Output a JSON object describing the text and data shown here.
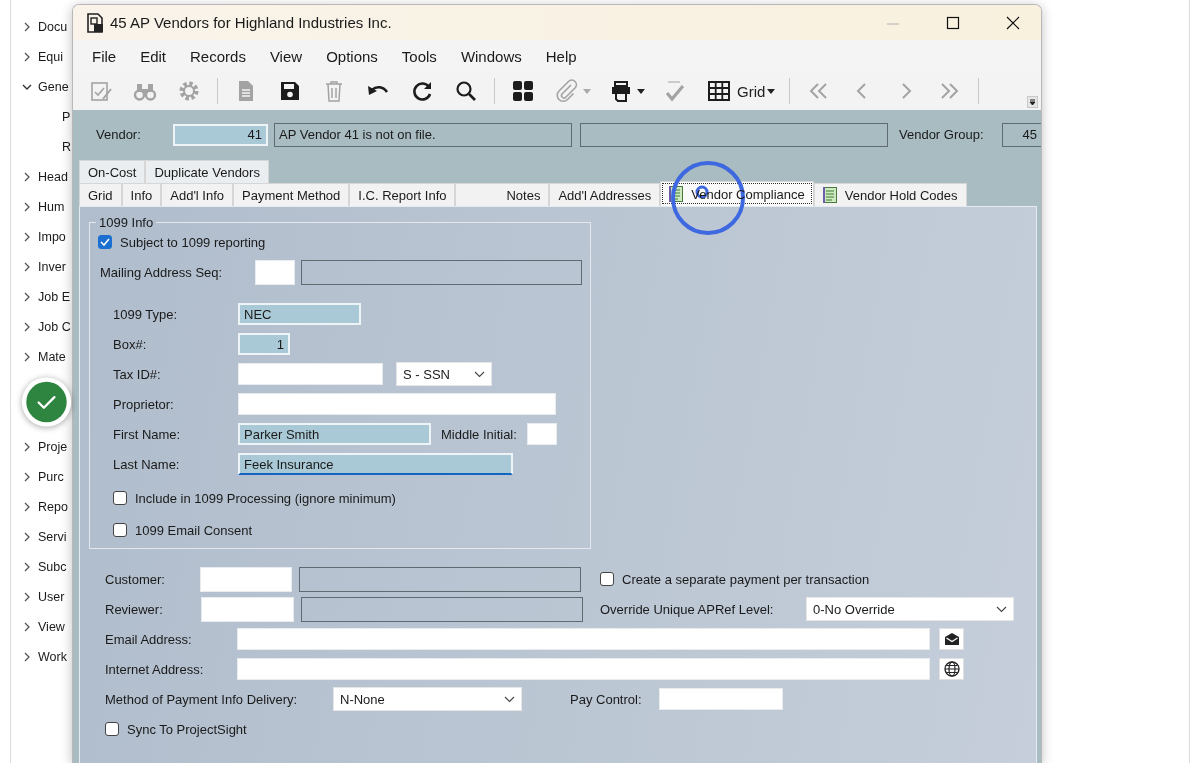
{
  "sidebar": {
    "items": [
      {
        "kind": "node",
        "label": "Docu",
        "expanded": false
      },
      {
        "kind": "node",
        "label": "Equi",
        "expanded": false
      },
      {
        "kind": "node",
        "label": "Gene",
        "expanded": true,
        "children": [
          {
            "label": "P"
          },
          {
            "label": "R"
          }
        ]
      },
      {
        "kind": "node",
        "label": "Head",
        "expanded": false
      },
      {
        "kind": "node",
        "label": "Hum",
        "expanded": false
      },
      {
        "kind": "node",
        "label": "Impo",
        "expanded": false
      },
      {
        "kind": "node",
        "label": "Inver",
        "expanded": false
      },
      {
        "kind": "node",
        "label": "Job E",
        "expanded": false
      },
      {
        "kind": "node",
        "label": "Job C",
        "expanded": false
      },
      {
        "kind": "node",
        "label": "Mate",
        "expanded": false
      },
      {
        "kind": "badge"
      },
      {
        "kind": "node",
        "label": "Proje",
        "expanded": false
      },
      {
        "kind": "node",
        "label": "Purc",
        "expanded": false
      },
      {
        "kind": "node",
        "label": "Repo",
        "expanded": false
      },
      {
        "kind": "node",
        "label": "Servi",
        "expanded": false
      },
      {
        "kind": "node",
        "label": "Subc",
        "expanded": false
      },
      {
        "kind": "node",
        "label": "User",
        "expanded": false
      },
      {
        "kind": "node",
        "label": "View",
        "expanded": false
      },
      {
        "kind": "node",
        "label": "Work",
        "expanded": false
      }
    ]
  },
  "window": {
    "title": "45 AP Vendors for Highland Industries Inc.",
    "controls": [
      {
        "disabled": true
      },
      {
        "disabled": false
      },
      {
        "disabled": false
      }
    ]
  },
  "menu": [
    "File",
    "Edit",
    "Records",
    "View",
    "Options",
    "Tools",
    "Windows",
    "Help"
  ],
  "toolbar": {
    "items": [
      {
        "kind": "button",
        "disabled": true
      },
      {
        "kind": "button",
        "disabled": true
      },
      {
        "kind": "button",
        "disabled": true
      },
      {
        "kind": "separator"
      },
      {
        "kind": "button",
        "disabled": true
      },
      {
        "kind": "button",
        "disabled": false
      },
      {
        "kind": "button",
        "disabled": true
      },
      {
        "kind": "button",
        "disabled": false
      },
      {
        "kind": "button",
        "disabled": false
      },
      {
        "kind": "button",
        "disabled": false
      },
      {
        "kind": "separator"
      },
      {
        "kind": "button",
        "disabled": false
      },
      {
        "kind": "split",
        "disabled": true
      },
      {
        "kind": "split",
        "disabled": false
      },
      {
        "kind": "button",
        "disabled": true
      },
      {
        "kind": "split",
        "disabled": false,
        "label": "Grid"
      },
      {
        "kind": "separator"
      },
      {
        "kind": "button",
        "disabled": true
      },
      {
        "kind": "button",
        "disabled": true
      },
      {
        "kind": "button",
        "disabled": true
      },
      {
        "kind": "button",
        "disabled": true
      },
      {
        "kind": "separator"
      }
    ]
  },
  "vendor_bar": {
    "vendor_label": "Vendor:",
    "vendor": "41",
    "description": "AP Vendor 41 is not on file.",
    "vendor_group_label": "Vendor Group:",
    "vendor_group": "45"
  },
  "tabs": {
    "row_1": [
      {
        "label": "On-Cost",
        "selected": false
      },
      {
        "label": "Duplicate Vendors",
        "selected": false
      }
    ],
    "row_2": [
      {
        "label": "Grid",
        "selected": false
      },
      {
        "label": "Info",
        "selected": false
      },
      {
        "label": "Add'l Info",
        "selected": false
      },
      {
        "label": "Payment Method",
        "selected": false
      },
      {
        "label": "I.C. Report Info",
        "selected": false
      },
      {
        "label": "Notes",
        "selected": false
      },
      {
        "label": "Add'l Addresses",
        "selected": false
      },
      {
        "label": "Vendor Compliance",
        "selected": true,
        "has_icon": true
      },
      {
        "label": "Vendor Hold Codes",
        "selected": false,
        "has_icon": true
      }
    ]
  },
  "info_1099": {
    "title": "1099 Info",
    "subject": {
      "label": "Subject to 1099 reporting",
      "checked": true
    },
    "mailing_address_seq": {
      "label": "Mailing Address Seq:"
    },
    "type": {
      "label": "1099 Type:",
      "value": "NEC",
      "highlighted": true
    },
    "box": {
      "label": "Box#:",
      "value": "1",
      "highlighted": true
    },
    "tax_id": {
      "label": "Tax ID#:",
      "highlighted": false,
      "id_type": "S - SSN"
    },
    "proprietor": {
      "label": "Proprietor:",
      "highlighted": false
    },
    "first_name": {
      "label": "First Name:",
      "value": "Parker Smith",
      "highlighted": true
    },
    "middle_initial": {
      "label": "Middle Initial:",
      "highlighted": false
    },
    "last_name": {
      "label": "Last Name:",
      "value": "Feek Insurance",
      "highlighted": true,
      "focused": true
    },
    "include": {
      "label": "Include in 1099 Processing (ignore minimum)",
      "checked": false
    },
    "email_consent": {
      "label": "1099 Email Consent",
      "checked": false
    }
  },
  "details": {
    "customer": {
      "label": "Customer:"
    },
    "separate_payment": {
      "label": "Create a separate payment per transaction",
      "checked": false
    },
    "reviewer": {
      "label": "Reviewer:"
    },
    "override": {
      "label": "Override Unique APRef Level:",
      "value": "0-No Override"
    },
    "email": {
      "label": "Email Address:"
    },
    "internet": {
      "label": "Internet Address:"
    },
    "method": {
      "label": "Method of Payment Info Delivery:",
      "value": "N-None"
    },
    "pay_control": {
      "label": "Pay Control:"
    },
    "sync": {
      "label": "Sync To ProjectSight",
      "checked": false
    }
  }
}
